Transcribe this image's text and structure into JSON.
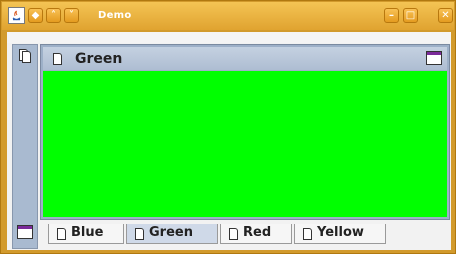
{
  "window": {
    "title": "Demo",
    "buttons": {
      "restore": "◆",
      "up": "˄",
      "down": "˅",
      "minimize": "–",
      "maximize": "□",
      "close": "✕"
    },
    "frame_color": "#d29a2c"
  },
  "internal_frame": {
    "title": "Green",
    "content_color": "#00ff00"
  },
  "tabs": [
    {
      "label": "Blue",
      "selected": false
    },
    {
      "label": "Green",
      "selected": true
    },
    {
      "label": "Red",
      "selected": false
    },
    {
      "label": "Yellow",
      "selected": false
    }
  ]
}
